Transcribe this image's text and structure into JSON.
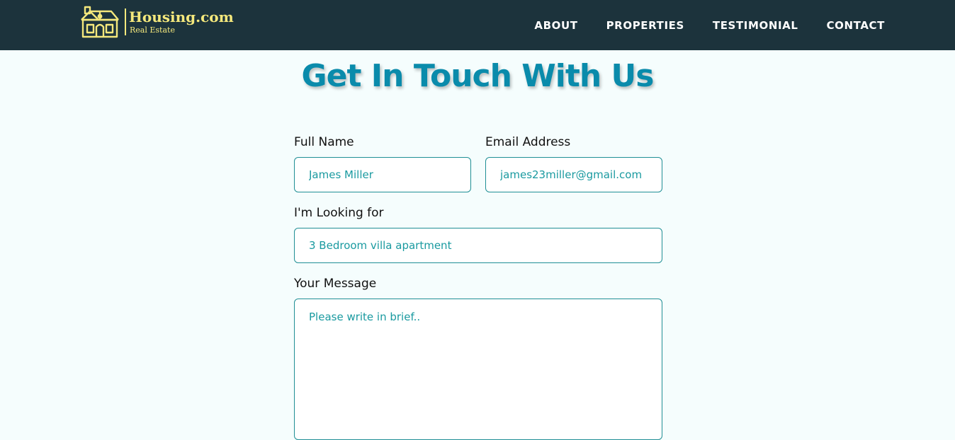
{
  "header": {
    "brand": "Housing.com",
    "tagline": "Real Estate",
    "logo_icon": "house-icon",
    "nav": [
      {
        "label": "ABOUT"
      },
      {
        "label": "PROPERTIES"
      },
      {
        "label": "TESTIMONIAL"
      },
      {
        "label": "CONTACT"
      }
    ]
  },
  "main": {
    "title": "Get In Touch With Us",
    "form": {
      "full_name": {
        "label": "Full Name",
        "value": "James Miller"
      },
      "email": {
        "label": "Email Address",
        "value": "james23miller@gmail.com"
      },
      "looking_for": {
        "label": "I'm Looking for",
        "value": "3 Bedroom villa apartment"
      },
      "message": {
        "label": "Your Message",
        "placeholder": "Please write in brief.."
      }
    }
  },
  "colors": {
    "navbar_bg": "#1c333c",
    "logo_yellow": "#f4e87c",
    "title_teal": "#0a8bab",
    "field_border": "#1f8f95",
    "field_text": "#1a9aa0",
    "page_bg": "#f5fdfd"
  }
}
